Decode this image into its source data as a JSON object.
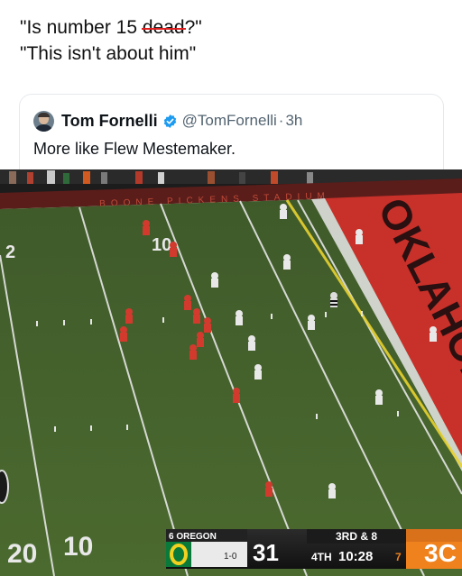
{
  "caption": {
    "line1_prefix": "\"Is number 15 ",
    "line1_struck": "dead",
    "line1_suffix": "?\"",
    "line2": "\"This isn't about him\""
  },
  "quoted_tweet": {
    "display_name": "Tom Fornelli",
    "handle": "@TomFornelli",
    "separator": "·",
    "time": "3h",
    "text": "More like Flew Mestemaker.",
    "verified_color": "#1d9bf0"
  },
  "broadcast": {
    "stadium_banner": "BOONE PICKENS STADIUM",
    "endzone_text": "OKLAHOMA ST",
    "yard_marker_top": "10",
    "yard_marker_left_top": "2",
    "yard_marker_bottom_left": "20",
    "yard_marker_bottom_mid": "10",
    "scorebug": {
      "away_rank_team": "6 OREGON",
      "away_record": "1-0",
      "away_score": "31",
      "down_distance": "3RD & 8",
      "quarter": "4TH",
      "clock": "10:28",
      "play_clock": "7",
      "home_score": "3C",
      "oregon_green": "#0a7a3a",
      "osu_orange": "#f0821e"
    }
  }
}
